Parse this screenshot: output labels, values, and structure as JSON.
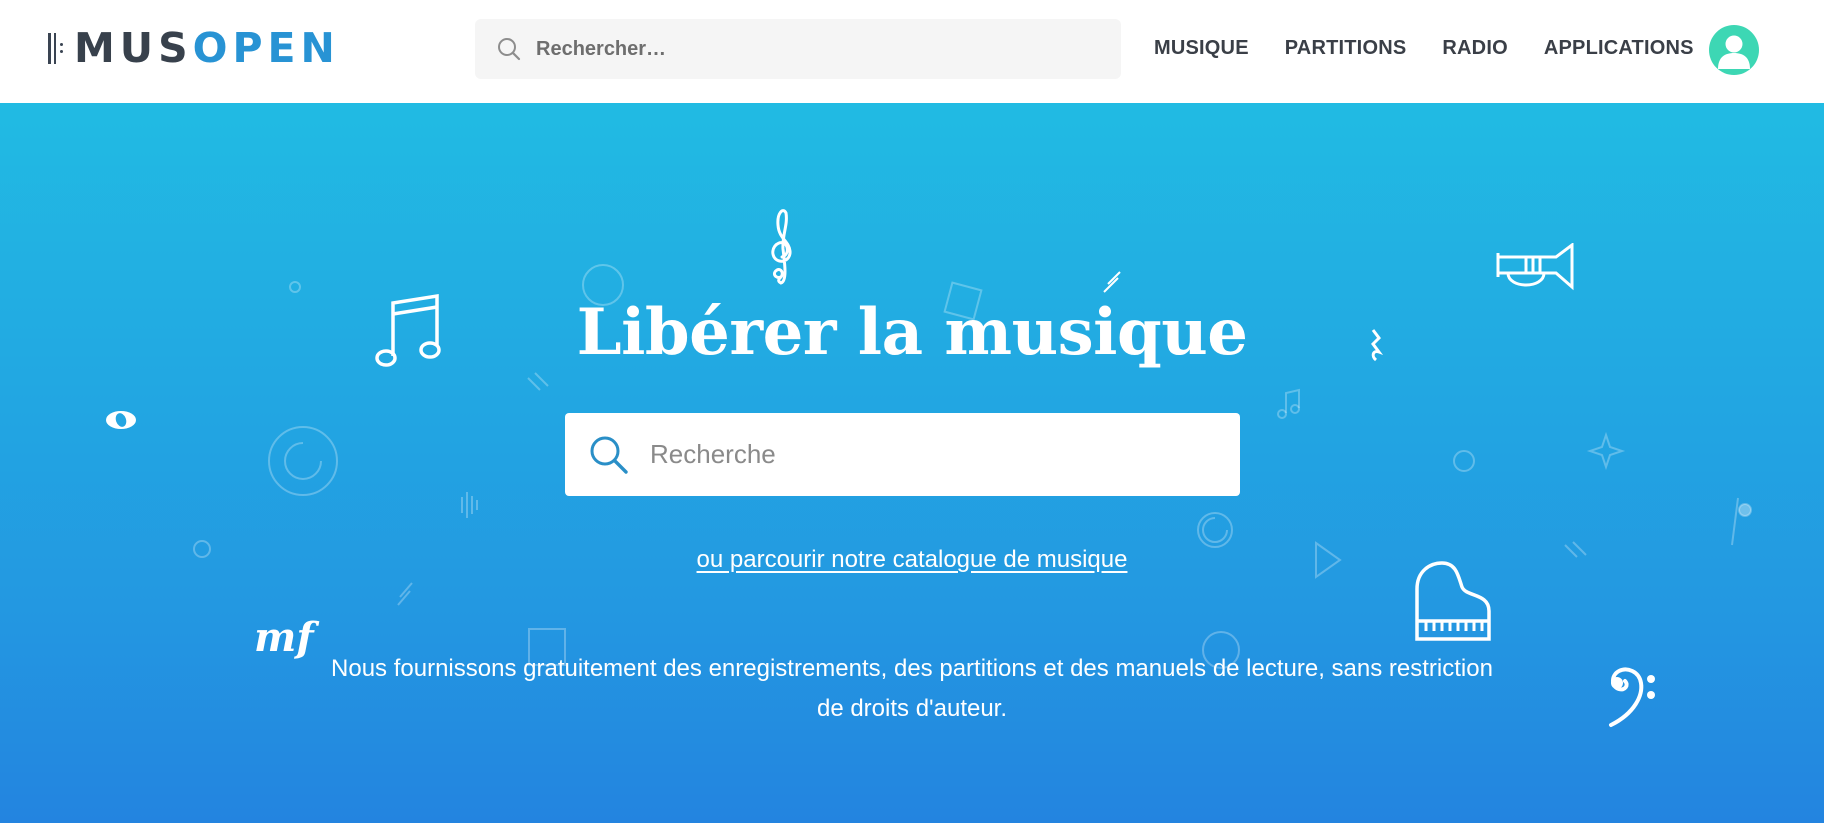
{
  "header": {
    "logo": {
      "part1": "MUS",
      "part2": "OPEN"
    },
    "search": {
      "placeholder": "Rechercher…"
    },
    "nav": [
      {
        "label": "MUSIQUE"
      },
      {
        "label": "PARTITIONS"
      },
      {
        "label": "RADIO"
      },
      {
        "label": "APPLICATIONS"
      }
    ],
    "avatar_icon": "user-icon"
  },
  "hero": {
    "title": "Libérer la musique",
    "search": {
      "placeholder": "Recherche"
    },
    "catalog_link": "ou parcourir notre catalogue de musique",
    "tagline": "Nous fournissons gratuitement des enregistrements, des partitions et des manuels de lecture, sans restriction de droits d'auteur.",
    "decorations": {
      "dynamic_marking": "mf"
    }
  },
  "colors": {
    "brand_dark": "#38414c",
    "brand_blue": "#2893d4",
    "hero_top": "#21bbe3",
    "hero_bottom": "#2384e0",
    "avatar": "#3dd7b4"
  }
}
